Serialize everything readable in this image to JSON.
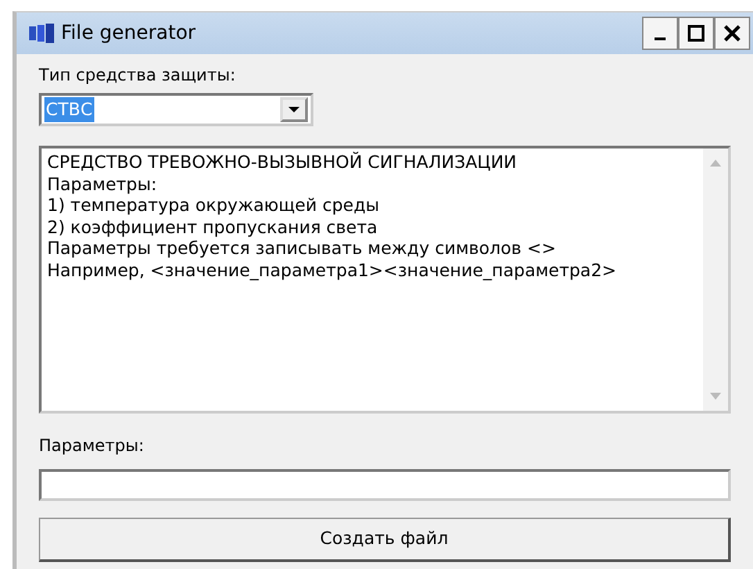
{
  "window": {
    "title": "File generator"
  },
  "protection_type": {
    "label": "Тип средства защиты:",
    "value": "СТВС",
    "selected": true
  },
  "description": {
    "lines": [
      "СРЕДСТВО ТРЕВОЖНО-ВЫЗЫВНОЙ СИГНАЛИЗАЦИИ",
      "Параметры:",
      "1) температура окружающей среды",
      "2) коэффициент пропускания света",
      "Параметры требуется записывать между символов <>",
      "Например, <значение_параметра1><значение_параметра2>"
    ]
  },
  "parameters": {
    "label": "Параметры:"
  },
  "buttons": [
    "Создать файл"
  ]
}
